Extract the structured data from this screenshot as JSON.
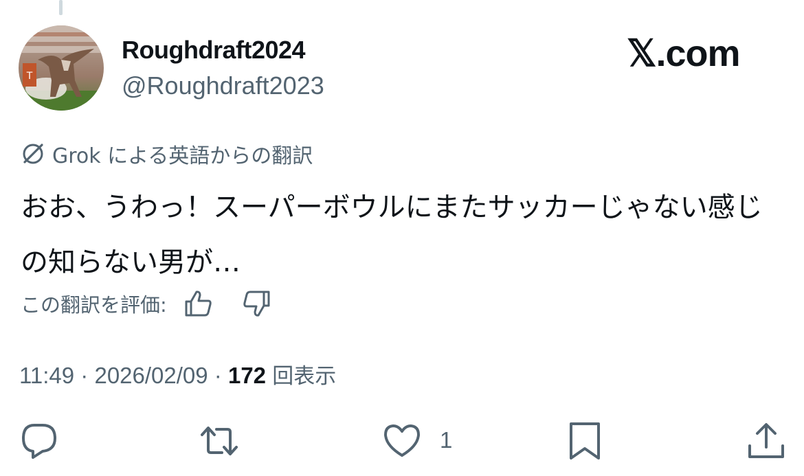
{
  "author": {
    "display_name": "Roughdraft2024",
    "handle": "@Roughdraft2023",
    "avatar_icon": "longhorn-avatar"
  },
  "brand": "𝕏.com",
  "translation": {
    "icon": "grok-icon",
    "label": "Grok による英語からの翻訳",
    "text": "おお、うわっ！スーパーボウルにまたサッカーじゃない感じの知らない男が…"
  },
  "rating": {
    "label": "この翻訳を評価:",
    "thumbs_up_icon": "thumbs-up-icon",
    "thumbs_down_icon": "thumbs-down-icon"
  },
  "meta": {
    "time": "11:49",
    "separator": " · ",
    "date": "2026/02/09",
    "view_count": "172",
    "views_label": "回表示"
  },
  "actions": {
    "reply_icon": "reply-icon",
    "retweet_icon": "retweet-icon",
    "like_icon": "heart-icon",
    "like_count": "1",
    "bookmark_icon": "bookmark-icon",
    "share_icon": "share-icon"
  },
  "colors": {
    "text_primary": "#0f1419",
    "text_secondary": "#536471",
    "thread_line": "#cfd9de"
  }
}
